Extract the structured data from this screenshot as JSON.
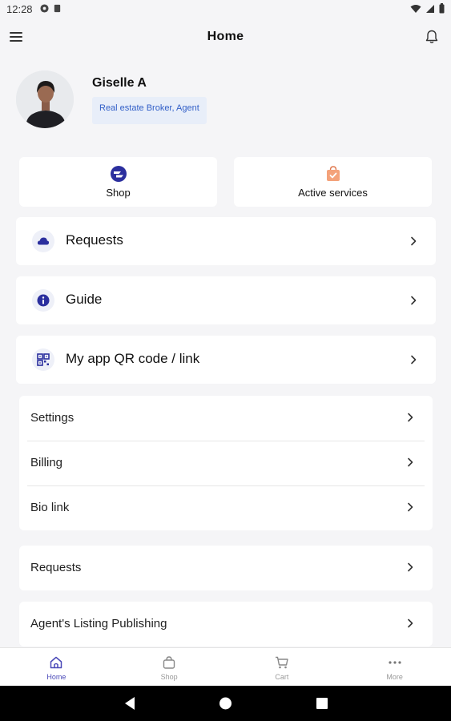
{
  "status_bar": {
    "time": "12:28"
  },
  "app_bar": {
    "title": "Home"
  },
  "profile": {
    "name": "Giselle A",
    "role": "Real estate Broker, Agent"
  },
  "quick_actions": [
    {
      "label": "Shop",
      "icon": "shop-badge-icon"
    },
    {
      "label": "Active services",
      "icon": "shopping-bag-check-icon"
    }
  ],
  "menu_cards": [
    {
      "label": "Requests",
      "icon": "cloud-icon"
    },
    {
      "label": "Guide",
      "icon": "info-icon"
    },
    {
      "label": "My app QR code / link",
      "icon": "qr-code-icon"
    }
  ],
  "settings_group": [
    {
      "label": "Settings"
    },
    {
      "label": "Billing"
    },
    {
      "label": "Bio link"
    }
  ],
  "extra_items": [
    {
      "label": "Requests"
    },
    {
      "label": "Agent's Listing Publishing"
    }
  ],
  "bottom_nav": [
    {
      "label": "Home",
      "icon": "home-icon",
      "active": true
    },
    {
      "label": "Shop",
      "icon": "bag-icon"
    },
    {
      "label": "Cart",
      "icon": "cart-icon"
    },
    {
      "label": "More",
      "icon": "more-dots-icon"
    }
  ],
  "colors": {
    "accent": "#2b2f9e",
    "role_bg": "#e8eef9",
    "role_text": "#3360c8",
    "orange": "#f4a27a"
  }
}
